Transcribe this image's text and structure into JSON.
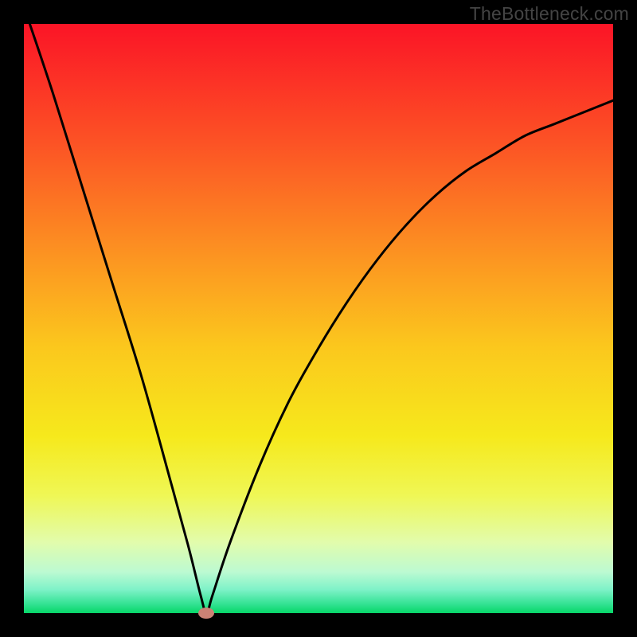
{
  "watermark": "TheBottleneck.com",
  "chart_data": {
    "type": "line",
    "title": "",
    "xlabel": "",
    "ylabel": "",
    "xlim": [
      0,
      100
    ],
    "ylim": [
      0,
      100
    ],
    "optimum_x": 31,
    "series": [
      {
        "name": "bottleneck-curve",
        "x": [
          1,
          5,
          10,
          15,
          20,
          25,
          28,
          30,
          31,
          32,
          35,
          40,
          45,
          50,
          55,
          60,
          65,
          70,
          75,
          80,
          85,
          90,
          95,
          100
        ],
        "values": [
          100,
          88,
          72,
          56,
          40,
          22,
          11,
          3,
          0,
          3,
          12,
          25,
          36,
          45,
          53,
          60,
          66,
          71,
          75,
          78,
          81,
          83,
          85,
          87
        ]
      }
    ],
    "marker": {
      "x": 31,
      "y": 0
    },
    "gradient_stops": [
      {
        "offset": 0.0,
        "color": "#fb1426"
      },
      {
        "offset": 0.2,
        "color": "#fc5225"
      },
      {
        "offset": 0.4,
        "color": "#fc9621"
      },
      {
        "offset": 0.55,
        "color": "#fbc81d"
      },
      {
        "offset": 0.7,
        "color": "#f6e91c"
      },
      {
        "offset": 0.8,
        "color": "#eff755"
      },
      {
        "offset": 0.88,
        "color": "#e2fcac"
      },
      {
        "offset": 0.93,
        "color": "#bcfad2"
      },
      {
        "offset": 0.96,
        "color": "#7ef2c8"
      },
      {
        "offset": 0.985,
        "color": "#32e292"
      },
      {
        "offset": 1.0,
        "color": "#07d668"
      }
    ]
  }
}
